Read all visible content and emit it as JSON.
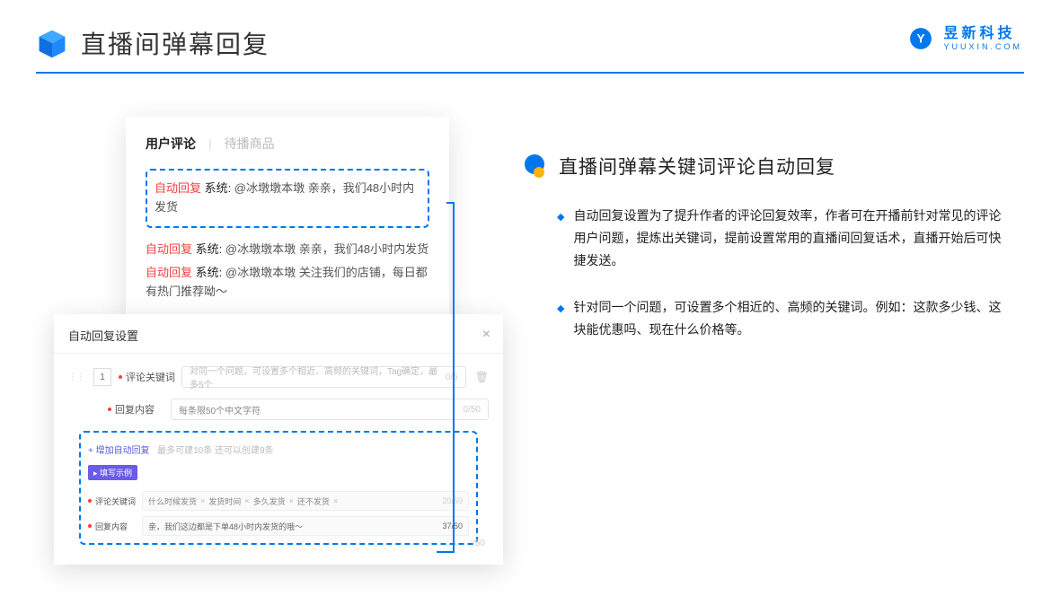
{
  "header": {
    "title": "直播间弹幕回复",
    "brand_cn": "昱新科技",
    "brand_en": "YUUXIN.COM"
  },
  "comments": {
    "tab_active": "用户评论",
    "tab_inactive": "待播商品",
    "highlighted": {
      "label": "自动回复",
      "sys": "系统:",
      "text": "@冰墩墩本墩 亲亲，我们48小时内发货"
    },
    "line2": {
      "label": "自动回复",
      "sys": "系统:",
      "text": "@冰墩墩本墩 亲亲，我们48小时内发货"
    },
    "line3": {
      "label": "自动回复",
      "sys": "系统:",
      "text": "@冰墩墩本墩 关注我们的店铺，每日都有热门推荐呦～"
    }
  },
  "settings": {
    "title": "自动回复设置",
    "num": "1",
    "kw_label": "评论关键词",
    "kw_placeholder": "对同一个问题，可设置多个相近、高频的关键词，Tag确定，最多5个",
    "kw_count": "0/5",
    "content_label": "回复内容",
    "content_placeholder": "每条限50个中文字符",
    "content_count": "0/50",
    "add_link": "+ 增加自动回复",
    "add_hint": "最多可建10条 还可以创建9条",
    "badge": "▸ 填写示例",
    "ex_kw_label": "评论关键词",
    "ex_tags": [
      "什么时候发货",
      "发货时间",
      "多久发货",
      "还不发货"
    ],
    "ex_kw_count": "20/50",
    "ex_content_label": "回复内容",
    "ex_content_text": "亲，我们这边都是下单48小时内发货的哦～",
    "ex_content_count": "37/50",
    "bottom_count": "/50"
  },
  "section": {
    "title": "直播间弹幕关键词评论自动回复",
    "bullets": [
      "自动回复设置为了提升作者的评论回复效率，作者可在开播前针对常见的评论用户问题，提炼出关键词，提前设置常用的直播间回复话术，直播开始后可快捷发送。",
      "针对同一个问题，可设置多个相近的、高频的关键词。例如：这款多少钱、这块能优惠吗、现在什么价格等。"
    ]
  }
}
